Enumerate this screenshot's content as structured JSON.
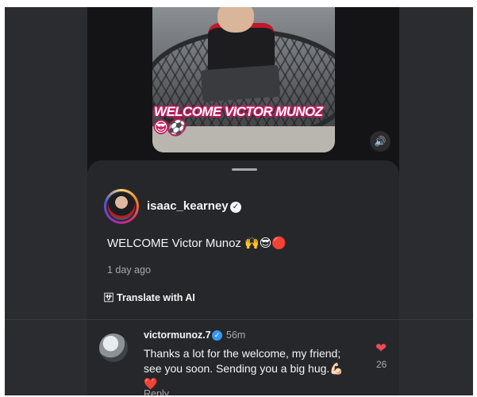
{
  "video": {
    "caption": "WELCOME VICTOR MUNOZ 😎⚽",
    "sound_icon": "speaker-icon"
  },
  "post": {
    "username": "isaac_kearney",
    "verified_icon": "verified-badge-icon",
    "text": "WELCOME Victor Munoz 🙌😎🔴",
    "time": "1 day ago",
    "translate_label": "Translate with AI"
  },
  "comment": {
    "username": "victormunoz.7",
    "time": "56m",
    "text": "Thanks a lot for the welcome, my friend; see you soon. Sending you a big hug.💪🏻",
    "text_end": "❤️",
    "reply_label": "Reply",
    "like_count": "26",
    "liked": true
  },
  "colors": {
    "background": "#2b2c30",
    "panel": "#26272b",
    "like_red": "#ed4956",
    "verified_blue": "#3897f0"
  }
}
